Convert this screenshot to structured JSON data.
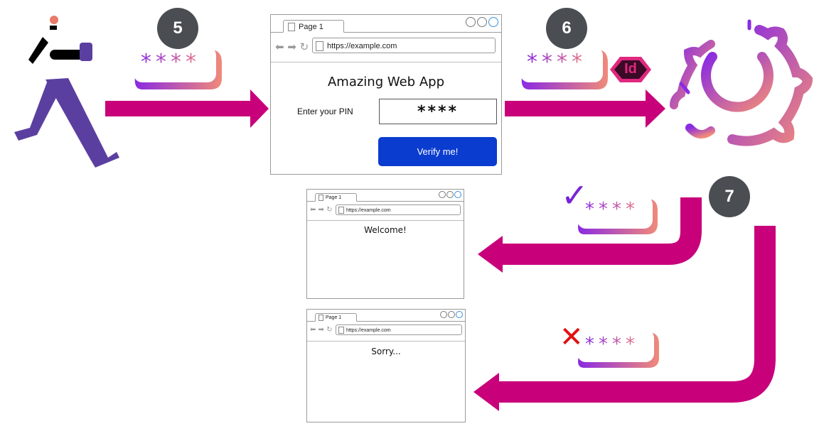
{
  "steps": {
    "step5": "5",
    "step6": "6",
    "step7": "7"
  },
  "pin_mask": "****",
  "id_badge": "Id",
  "success_mark": "✓",
  "fail_mark": "✕",
  "main_browser": {
    "tab_label": "Page 1",
    "url": "https://example.com",
    "app_title": "Amazing Web App",
    "pin_label": "Enter your PIN",
    "pin_value": "****",
    "verify_button": "Verify me!"
  },
  "success_browser": {
    "tab_label": "Page 1",
    "url": "https://example.com",
    "message": "Welcome!"
  },
  "failure_browser": {
    "tab_label": "Page 1",
    "url": "https://example.com",
    "message": "Sorry..."
  },
  "colors": {
    "arrow": "#c8007a",
    "badge": "#4a4d52",
    "verify_button": "#0a3ccf",
    "gradient_start": "#8a2be2",
    "gradient_end": "#e87a80",
    "runner_body": "#5b3fa0",
    "emoji_face": "#f4a52a"
  },
  "icons": {
    "runner": "running-person-icon",
    "service": "gear-power-icon",
    "happy": "heart-eyes-emoji-icon",
    "sad": "frowning-emoji-icon"
  }
}
